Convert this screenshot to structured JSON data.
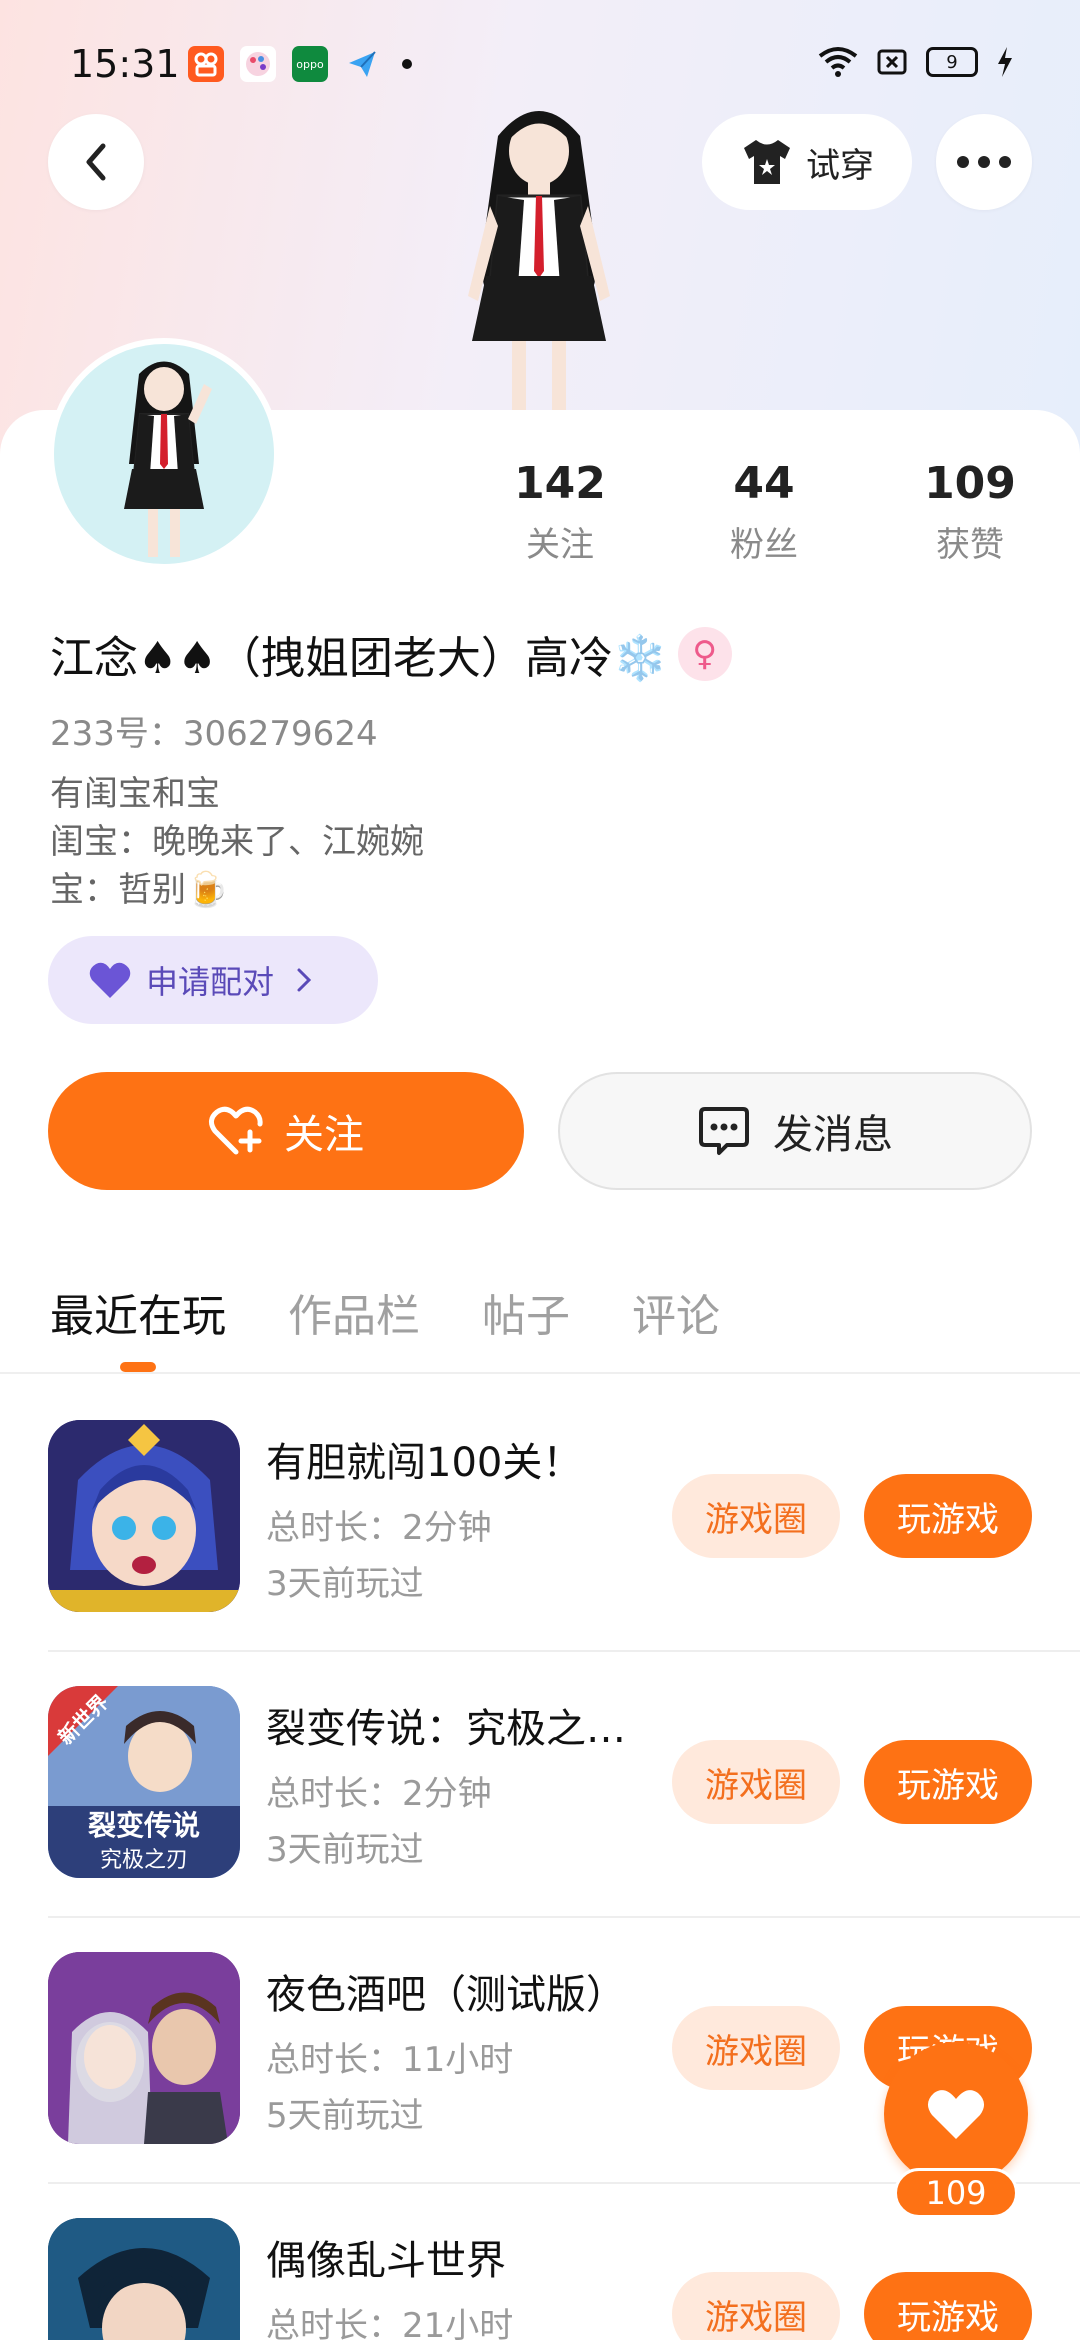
{
  "status_bar": {
    "time": "15:31",
    "battery": "9",
    "app_icons": [
      "kuaishou-app",
      "paint-app",
      "oppo-app",
      "send-app"
    ]
  },
  "header": {
    "back_icon": "chevron-left-icon",
    "tryon_label": "试穿",
    "more_icon": "more-dots-icon"
  },
  "profile": {
    "stats": [
      {
        "value": "142",
        "label": "关注"
      },
      {
        "value": "44",
        "label": "粉丝"
      },
      {
        "value": "109",
        "label": "获赞"
      }
    ],
    "name": "江念♠♠（拽姐团老大）高冷❄️",
    "gender_symbol": "♀",
    "uid": "233号：306279624",
    "bio_lines": [
      "有闺宝和宝",
      "闺宝：晚晚来了、江婉婉",
      "宝：哲别🍺"
    ],
    "pair_label": "申请配对",
    "follow_label": "关注",
    "message_label": "发消息"
  },
  "tabs": [
    {
      "label": "最近在玩",
      "active": true
    },
    {
      "label": "作品栏",
      "active": false
    },
    {
      "label": "帖子",
      "active": false
    },
    {
      "label": "评论",
      "active": false
    }
  ],
  "games": [
    {
      "title": "有胆就闯100关！",
      "duration": "总时长：2分钟",
      "last_played": "3天前玩过",
      "circle_label": "游戏圈",
      "play_label": "玩游戏"
    },
    {
      "title": "裂变传说：究极之…",
      "duration": "总时长：2分钟",
      "last_played": "3天前玩过",
      "circle_label": "游戏圈",
      "play_label": "玩游戏",
      "thumb_badge": "新世界",
      "thumb_text_1": "裂变传说",
      "thumb_text_2": "究极之刃"
    },
    {
      "title": "夜色酒吧（测试版）",
      "duration": "总时长：11小时",
      "last_played": "5天前玩过",
      "circle_label": "游戏圈",
      "play_label": "玩游戏"
    },
    {
      "title": "偶像乱斗世界",
      "duration": "总时长：21小时",
      "last_played": "",
      "circle_label": "游戏圈",
      "play_label": "玩游戏"
    }
  ],
  "like_fab": {
    "count": "109"
  },
  "colors": {
    "accent": "#fe7214",
    "pair_bg": "#ece7fb",
    "pair_text": "#5a4ab8"
  }
}
